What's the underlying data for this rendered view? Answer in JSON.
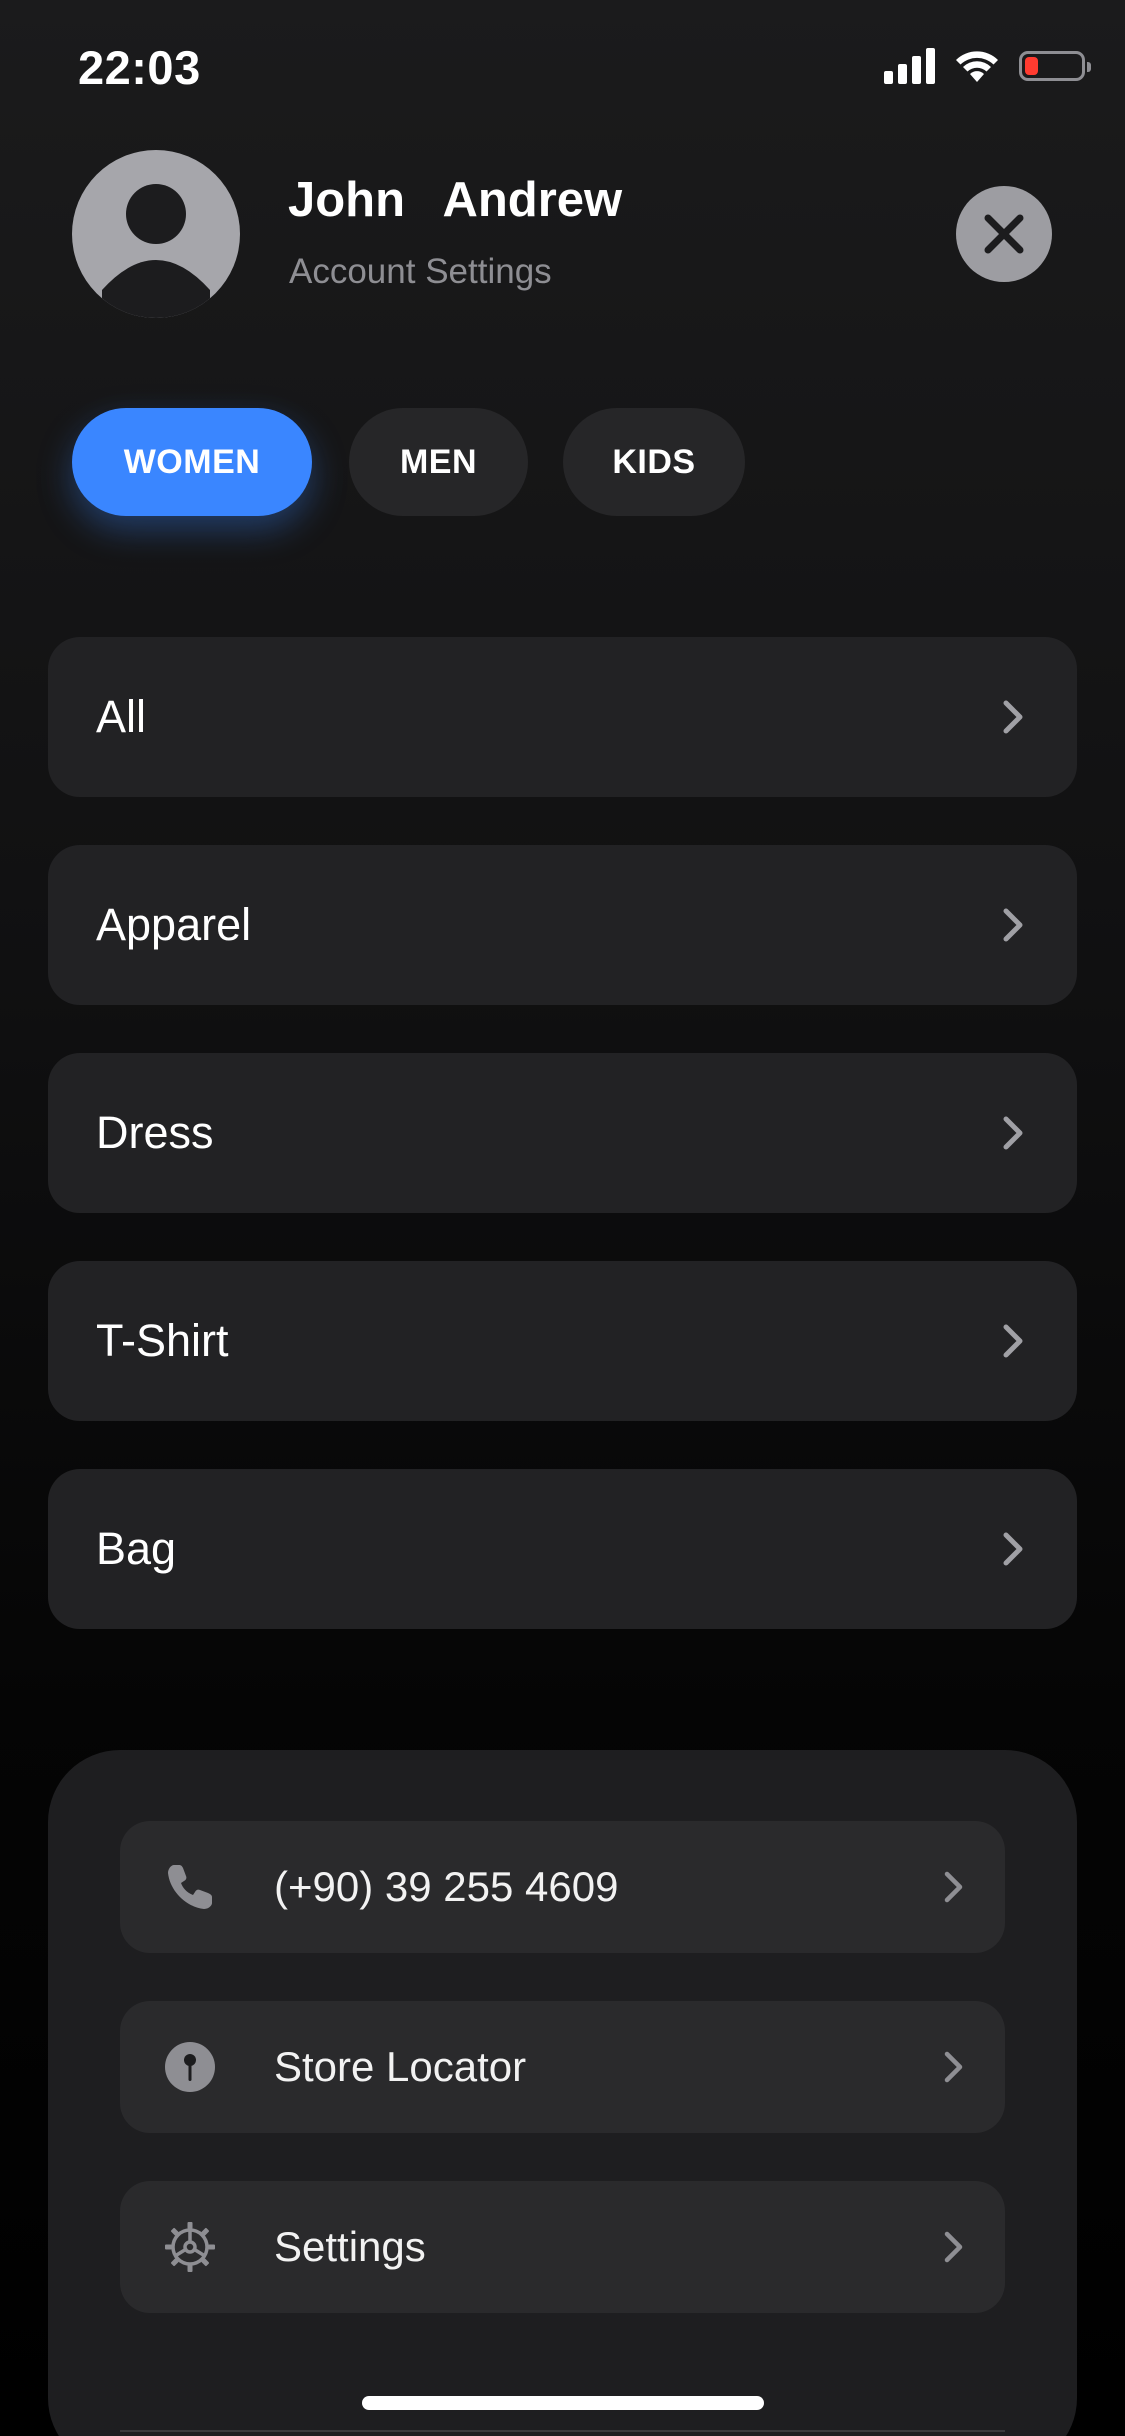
{
  "status_bar": {
    "time": "22:03",
    "signal_icon": "cellular-signal-icon",
    "wifi_icon": "wifi-icon",
    "battery_icon": "battery-low-icon",
    "battery_level": 0.12
  },
  "profile": {
    "name": "John  Andrew",
    "subtitle": "Account Settings",
    "avatar_icon": "user-silhouette-icon",
    "close_icon": "close-icon"
  },
  "tabs": [
    {
      "label": "WOMEN",
      "active": true
    },
    {
      "label": "MEN",
      "active": false
    },
    {
      "label": "KIDS",
      "active": false
    }
  ],
  "categories": [
    {
      "label": "All"
    },
    {
      "label": "Apparel"
    },
    {
      "label": "Dress"
    },
    {
      "label": "T-Shirt"
    },
    {
      "label": "Bag"
    }
  ],
  "contact_items": [
    {
      "label": "(+90) 39 255 4609",
      "icon": "phone-icon"
    },
    {
      "label": "Store Locator",
      "icon": "location-pin-icon"
    },
    {
      "label": "Settings",
      "icon": "gear-icon"
    }
  ],
  "colors": {
    "accent": "#3a86ff",
    "background": "#000000",
    "card": "#222224",
    "muted_text": "#8e8e93",
    "battery_low": "#ff3b30"
  }
}
